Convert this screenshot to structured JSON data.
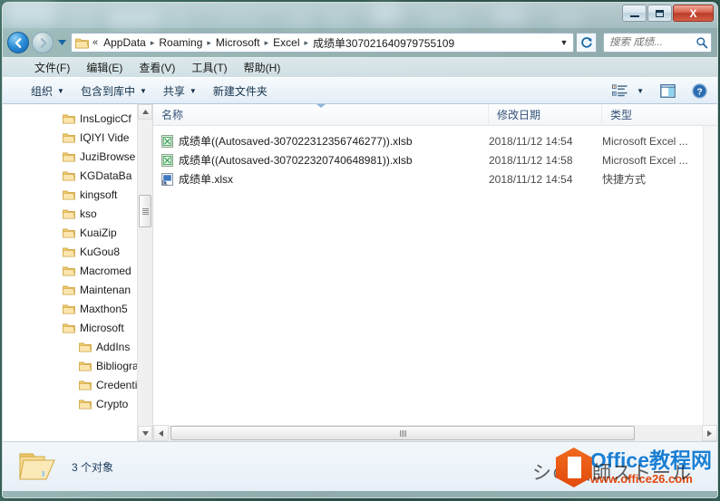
{
  "window": {
    "controls": {
      "minimize": "–",
      "maximize": "□",
      "close": "X"
    }
  },
  "address": {
    "back_icon": "back-arrow-icon",
    "forward_icon": "forward-arrow-icon",
    "history_icon": "chevron-down-icon",
    "chevron": "«",
    "crumbs": [
      "AppData",
      "Roaming",
      "Microsoft",
      "Excel",
      "成绩单307021640979755109"
    ],
    "separator": "▸",
    "dropdown": "▼",
    "refresh_icon": "refresh-icon"
  },
  "search": {
    "placeholder": "搜索 成绩...",
    "value": "",
    "icon": "search-icon"
  },
  "menubar": {
    "items": [
      {
        "label": "文件(F)",
        "text": "文件",
        "key": "F"
      },
      {
        "label": "编辑(E)",
        "text": "编辑",
        "key": "E"
      },
      {
        "label": "查看(V)",
        "text": "查看",
        "key": "V"
      },
      {
        "label": "工具(T)",
        "text": "工具",
        "key": "T"
      },
      {
        "label": "帮助(H)",
        "text": "帮助",
        "key": "H"
      }
    ]
  },
  "toolbar": {
    "organize": "组织",
    "include_in_library": "包含到库中",
    "share": "共享",
    "new_folder": "新建文件夹",
    "caret": "▼",
    "view_icon": "view-mode-icon",
    "view_caret": "▼",
    "preview_icon": "preview-pane-icon",
    "help_icon": "help-icon"
  },
  "navpane": {
    "items": [
      {
        "label": "InsLogicCf",
        "level": 1
      },
      {
        "label": "IQIYI Vide",
        "level": 1
      },
      {
        "label": "JuziBrowse",
        "level": 1
      },
      {
        "label": "KGDataBa",
        "level": 1
      },
      {
        "label": "kingsoft",
        "level": 1
      },
      {
        "label": "kso",
        "level": 1
      },
      {
        "label": "KuaiZip",
        "level": 1
      },
      {
        "label": "KuGou8",
        "level": 1
      },
      {
        "label": "Macromed",
        "level": 1
      },
      {
        "label": "Maintenan",
        "level": 1
      },
      {
        "label": "Maxthon5",
        "level": 1
      },
      {
        "label": "Microsoft",
        "level": 1
      },
      {
        "label": "AddIns",
        "level": 2
      },
      {
        "label": "Bibliogra",
        "level": 2
      },
      {
        "label": "Credenti",
        "level": 2
      },
      {
        "label": "Crypto",
        "level": 2
      }
    ],
    "scroll_up": "▲",
    "scroll_down": "▼"
  },
  "filelist": {
    "columns": [
      {
        "key": "name",
        "label": "名称"
      },
      {
        "key": "date",
        "label": "修改日期"
      },
      {
        "key": "type",
        "label": "类型"
      }
    ],
    "sorted_column": "name",
    "rows": [
      {
        "name": "成绩单((Autosaved-307022312356746277)).xlsb",
        "date": "2018/11/12 14:54",
        "type": "Microsoft Excel ...",
        "icon": "excel-file-icon"
      },
      {
        "name": "成绩单((Autosaved-307022320740648981)).xlsb",
        "date": "2018/11/12 14:58",
        "type": "Microsoft Excel ...",
        "icon": "excel-file-icon"
      },
      {
        "name": "成绩单.xlsx",
        "date": "2018/11/12 14:54",
        "type": "快捷方式",
        "icon": "shortcut-file-icon"
      }
    ],
    "scroll_left": "◀",
    "scroll_right": "▶"
  },
  "statusbar": {
    "folder_icon": "folder-icon",
    "item_count": "3 个对象"
  },
  "watermark": {
    "ghost_text": "シの語師ストール",
    "title": "Office教程网",
    "url": "www.office26.com",
    "logo_icon": "office-hex-logo-icon"
  },
  "colors": {
    "accent": "#1a7fd4",
    "close_button": "#c0392b",
    "watermark_orange": "#e0470d",
    "folder_yellow": "#f5ce6a"
  }
}
